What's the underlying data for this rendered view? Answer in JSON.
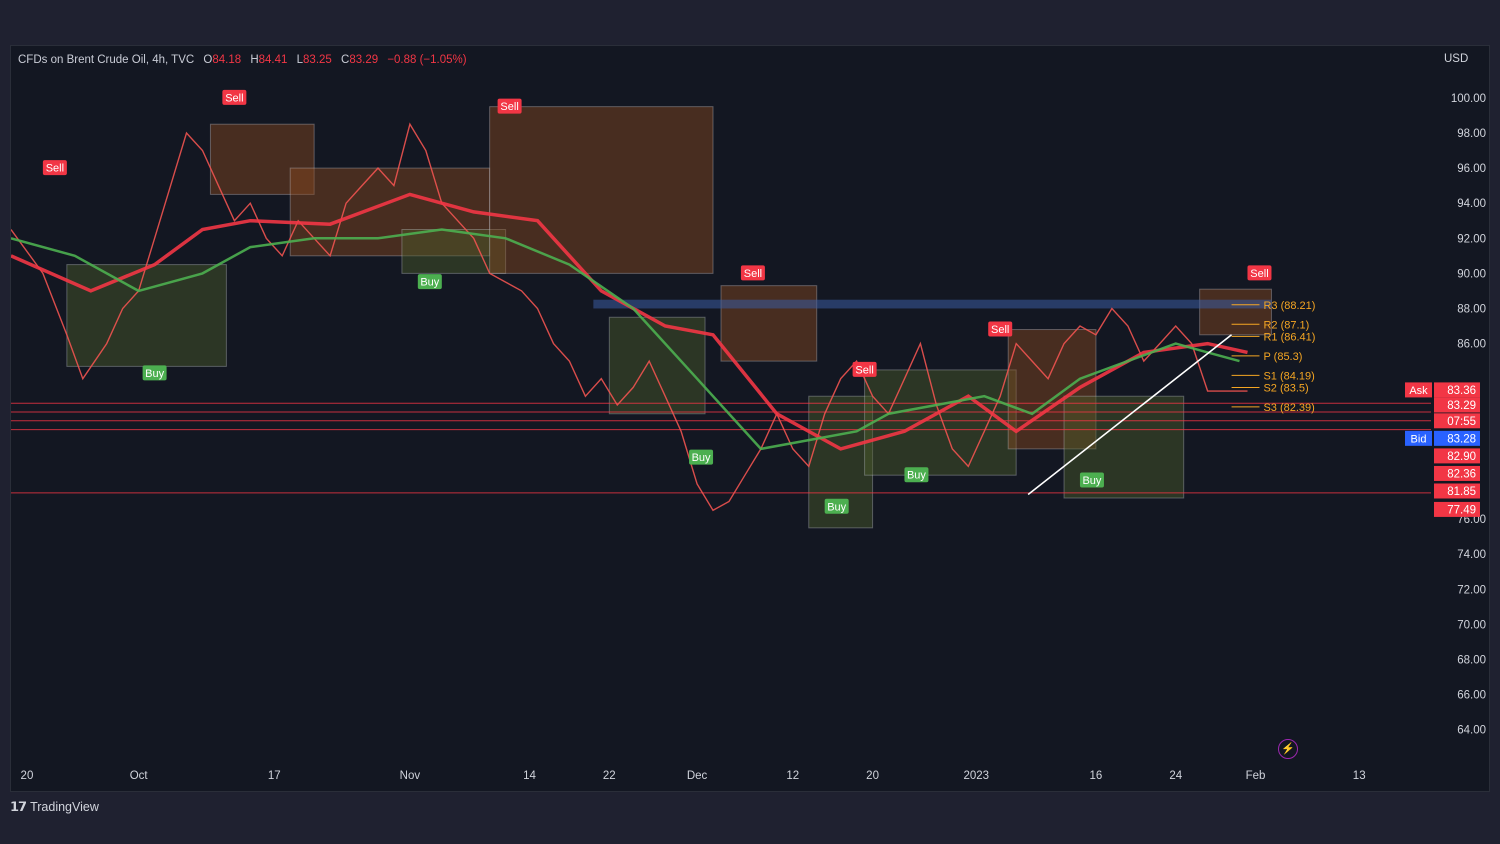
{
  "legend": {
    "symbol": "CFDs on Brent Crude Oil, 4h, TVC",
    "open_label": "O",
    "open": "84.18",
    "high_label": "H",
    "high": "84.41",
    "low_label": "L",
    "low": "83.25",
    "close_label": "C",
    "close": "83.29",
    "change": "−0.88 (−1.05%)"
  },
  "currency": "USD",
  "branding": {
    "logo": "TradingView"
  },
  "icons": {
    "bolt": "bolt-icon"
  },
  "colors": {
    "background": "#131722",
    "frame": "#1f2130",
    "bull": "#26a69a",
    "bear": "#ef5350",
    "ribbon_green": "#4caf50",
    "ribbon_red": "#f23645",
    "pivot": "#f5a623",
    "sell_badge": "#f23645",
    "buy_badge": "#4caf50",
    "resistance": "#3a5ba0"
  },
  "chart_data": {
    "type": "line",
    "title": "CFDs on Brent Crude Oil, 4h, TVC",
    "ylabel": "USD",
    "ylim": [
      62.5,
      102.5
    ],
    "y_ticks": [
      "100.00",
      "98.00",
      "96.00",
      "94.00",
      "92.00",
      "90.00",
      "88.00",
      "86.00",
      "76.00",
      "74.00",
      "72.00",
      "70.00",
      "68.00",
      "66.00",
      "64.00"
    ],
    "x_ticks": [
      {
        "label": "20",
        "x": 2
      },
      {
        "label": "Oct",
        "x": 16
      },
      {
        "label": "17",
        "x": 33
      },
      {
        "label": "Nov",
        "x": 50
      },
      {
        "label": "14",
        "x": 65
      },
      {
        "label": "22",
        "x": 75
      },
      {
        "label": "Dec",
        "x": 86
      },
      {
        "label": "12",
        "x": 98
      },
      {
        "label": "20",
        "x": 108
      },
      {
        "label": "2023",
        "x": 121
      },
      {
        "label": "16",
        "x": 136
      },
      {
        "label": "24",
        "x": 146
      },
      {
        "label": "Feb",
        "x": 156
      },
      {
        "label": "13",
        "x": 169
      }
    ],
    "x_range": [
      0,
      178
    ],
    "series": [
      {
        "values_x": [
          0,
          4,
          7,
          9,
          12,
          14,
          16,
          18,
          20,
          22,
          24,
          26,
          28,
          30,
          32,
          34,
          36,
          38,
          40,
          42,
          44,
          46,
          48,
          50,
          52,
          54,
          56,
          58,
          60,
          62,
          64,
          66,
          68,
          70,
          72,
          74,
          76,
          78,
          80,
          82,
          84,
          86,
          88,
          90,
          92,
          94,
          96,
          98,
          100,
          102,
          104,
          106,
          108,
          110,
          112,
          114,
          116,
          118,
          120,
          122,
          124,
          126,
          128,
          130,
          132,
          134,
          136,
          138,
          140,
          142,
          144,
          146,
          148,
          150,
          152,
          154,
          155
        ],
        "values_y": [
          92.5,
          90,
          86.5,
          84,
          86,
          88,
          89,
          92,
          95,
          98,
          97,
          95,
          93,
          94,
          92,
          91,
          93,
          92,
          91,
          94,
          95,
          96,
          95,
          98.5,
          97,
          94,
          93,
          92,
          90,
          89.5,
          89,
          88,
          86,
          85,
          83,
          84,
          82.5,
          83.5,
          85,
          83,
          81,
          78,
          76.5,
          77,
          78.5,
          80,
          82,
          80,
          79,
          82,
          84,
          85,
          83,
          82,
          84,
          86,
          82.5,
          80,
          79,
          81,
          83,
          86,
          85,
          84,
          86,
          87,
          86.5,
          88,
          87,
          85,
          86,
          87,
          86,
          83.3,
          83.29,
          83.29,
          83.29
        ]
      },
      {
        "name": "",
        "values_x": [
          0,
          10,
          18,
          24,
          30,
          40,
          50,
          58,
          66,
          74,
          82,
          88,
          96,
          104,
          112,
          120,
          126,
          134,
          142,
          150,
          155
        ],
        "values_y": [
          91,
          89,
          90.5,
          92.5,
          93,
          92.8,
          94.5,
          93.5,
          93,
          89,
          87,
          86.5,
          82,
          80,
          81,
          83,
          81,
          83.5,
          85.5,
          86,
          85.5
        ]
      },
      {
        "name": "",
        "values_x": [
          0,
          8,
          16,
          24,
          30,
          38,
          46,
          54,
          62,
          70,
          78,
          86,
          94,
          100,
          106,
          110,
          116,
          122,
          128,
          134,
          140,
          146,
          150,
          154
        ],
        "values_y": [
          92,
          91,
          89,
          90,
          91.5,
          92,
          92,
          92.5,
          92,
          90.5,
          88,
          84,
          80,
          80.5,
          81,
          82,
          82.5,
          83,
          82,
          84,
          85,
          86,
          85.5,
          85
        ]
      }
    ],
    "signals": [
      {
        "label": "Sell",
        "x": 5.5,
        "y": 96
      },
      {
        "label": "Sell",
        "x": 28,
        "y": 100
      },
      {
        "label": "Sell",
        "x": 62.5,
        "y": 99.5
      },
      {
        "label": "Sell",
        "x": 93,
        "y": 90
      },
      {
        "label": "Sell",
        "x": 107,
        "y": 84.5
      },
      {
        "label": "Sell",
        "x": 124,
        "y": 86.8
      },
      {
        "label": "Sell",
        "x": 156.5,
        "y": 90
      },
      {
        "label": "Buy",
        "x": 18,
        "y": 84.3
      },
      {
        "label": "Buy",
        "x": 52.5,
        "y": 89.5
      },
      {
        "label": "Buy",
        "x": 86.5,
        "y": 79.5
      },
      {
        "label": "Buy",
        "x": 103.5,
        "y": 76.7
      },
      {
        "label": "Buy",
        "x": 113.5,
        "y": 78.5
      },
      {
        "label": "Buy",
        "x": 135.5,
        "y": 78.2
      }
    ],
    "pivot_levels": [
      {
        "label": "R3 (88.21)",
        "value": 88.21
      },
      {
        "label": "R2 (87.1)",
        "value": 87.1
      },
      {
        "label": "R1 (86.41)",
        "value": 86.41
      },
      {
        "label": "P (85.3)",
        "value": 85.3
      },
      {
        "label": "S1 (84.19)",
        "value": 84.19
      },
      {
        "label": "S2 (83.5)",
        "value": 83.5
      },
      {
        "label": "S3 (82.39)",
        "value": 82.39
      }
    ],
    "price_tags": [
      {
        "label": "Ask",
        "value": "83.36",
        "y": 83.36,
        "color": "#f23645"
      },
      {
        "label": "",
        "value": "83.29",
        "y": 82.5,
        "color": "#f23645"
      },
      {
        "label": "",
        "value": "07:55",
        "y": 81.6,
        "color": "#f23645"
      },
      {
        "label": "Bid",
        "value": "83.28",
        "y": 80.6,
        "color": "#2962ff"
      },
      {
        "label": "",
        "value": "82.90",
        "y": 79.6,
        "color": "#f23645"
      },
      {
        "label": "",
        "value": "82.36",
        "y": 78.6,
        "color": "#f23645"
      },
      {
        "label": "",
        "value": "81.85",
        "y": 77.6,
        "color": "#f23645"
      },
      {
        "label": "",
        "value": "77.49",
        "y": 76.55,
        "color": "#f23645"
      }
    ],
    "horizontal_lines": [
      82.6,
      82.1,
      81.6,
      81.1,
      77.49
    ],
    "resistance_zone": [
      88.0,
      88.5
    ],
    "trendlines": [
      {
        "x1": 127.5,
        "y1": 77.4,
        "x2": 153,
        "y2": 86.5,
        "color": "#ffffff"
      }
    ],
    "shaded_boxes": [
      {
        "x1": 7,
        "x2": 27,
        "y1": 84.7,
        "y2": 90.5,
        "color": "#4b5e2a"
      },
      {
        "x1": 25,
        "x2": 38,
        "y1": 98.5,
        "y2": 94.5,
        "color": "#8a4a1e"
      },
      {
        "x1": 35,
        "x2": 60,
        "y1": 96,
        "y2": 91,
        "color": "#8a4a1e"
      },
      {
        "x1": 49,
        "x2": 62,
        "y1": 90,
        "y2": 92.5,
        "color": "#4b5e2a"
      },
      {
        "x1": 60,
        "x2": 88,
        "y1": 99.5,
        "y2": 90,
        "color": "#8a4a1e"
      },
      {
        "x1": 75,
        "x2": 87,
        "y1": 87.5,
        "y2": 82,
        "color": "#4b5e2a"
      },
      {
        "x1": 89,
        "x2": 101,
        "y1": 89.3,
        "y2": 85,
        "color": "#8a4a1e"
      },
      {
        "x1": 100,
        "x2": 108,
        "y1": 83,
        "y2": 75.5,
        "color": "#4b5e2a"
      },
      {
        "x1": 107,
        "x2": 126,
        "y1": 84.5,
        "y2": 78.5,
        "color": "#4b5e2a"
      },
      {
        "x1": 125,
        "x2": 136,
        "y1": 86.8,
        "y2": 80,
        "color": "#8a4a1e"
      },
      {
        "x1": 132,
        "x2": 147,
        "y1": 83,
        "y2": 77.2,
        "color": "#4b5e2a"
      },
      {
        "x1": 149,
        "x2": 158,
        "y1": 89.1,
        "y2": 86.5,
        "color": "#8a4a1e"
      }
    ]
  }
}
